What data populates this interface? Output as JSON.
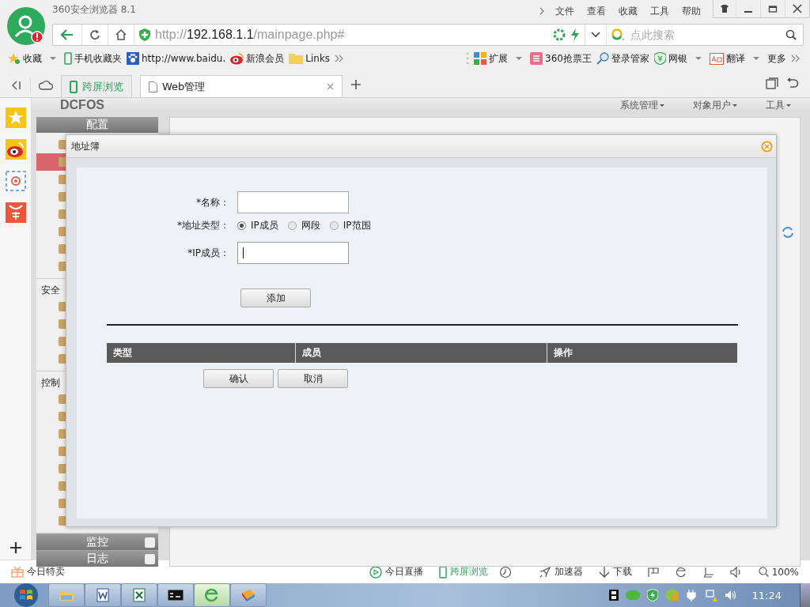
{
  "browser": {
    "title": "360安全浏览器 8.1",
    "menu": [
      "文件",
      "查看",
      "收藏",
      "工具",
      "帮助"
    ]
  },
  "address_bar": {
    "url": "http://**192.168.1.1**/mainpage.php#",
    "search": {
      "placeholder": "点此搜索"
    }
  },
  "bookmarks": {
    "left": [
      {
        "kind": "star",
        "label": "收藏",
        "dropdown": true
      },
      {
        "kind": "phone",
        "label": "手机收藏夹",
        "dropdown": false
      },
      {
        "kind": "paw",
        "label": "http://www.baidu.",
        "dropdown": false
      },
      {
        "kind": "eye",
        "label": "新浪会员",
        "dropdown": false
      },
      {
        "kind": "folder",
        "label": "Links",
        "dropdown": false
      }
    ],
    "right": [
      {
        "kind": "grid",
        "label": "扩展",
        "dropdown": true
      },
      {
        "kind": "ticket",
        "label": "360抢票王",
        "dropdown": false
      },
      {
        "kind": "key",
        "label": "登录管家",
        "dropdown": false
      },
      {
        "kind": "shield",
        "label": "网银",
        "dropdown": true
      },
      {
        "kind": "translate",
        "label": "翻译",
        "dropdown": true
      },
      {
        "kind": "more",
        "label": "更多",
        "dropdown": false
      }
    ]
  },
  "tabs": [
    {
      "kind": "app",
      "label": "跨屏浏览",
      "selected": false
    },
    {
      "kind": "page",
      "label": "Web管理",
      "selected": true
    }
  ],
  "page": {
    "logo": "DCFOS",
    "menu": [
      "系统管理",
      "对象用户",
      "工具"
    ],
    "nav": [
      {
        "kind": "header",
        "label": "配置"
      },
      {
        "kind": "section",
        "label": "安全"
      },
      {
        "kind": "section",
        "label": "控制"
      },
      {
        "kind": "footer",
        "label": "监控"
      },
      {
        "kind": "footer",
        "label": "日志"
      }
    ]
  },
  "dialog": {
    "title": "地址簿",
    "fields": [
      {
        "kind": "text",
        "label": "*名称："
      },
      {
        "kind": "radio",
        "label": "*地址类型：",
        "options": [
          {
            "label": "IP成员",
            "selected": true
          },
          {
            "label": "网段",
            "selected": false
          },
          {
            "label": "IP范围",
            "selected": false
          }
        ]
      },
      {
        "kind": "text",
        "label": "*IP成员：",
        "focused": true
      }
    ],
    "add_button": "添加",
    "table": {
      "columns": [
        "类型",
        "成员",
        "操作"
      ]
    },
    "buttons": [
      "确认",
      "取消"
    ]
  },
  "status_bar": {
    "left": "今日特卖",
    "right": [
      {
        "kind": "live",
        "label": "今日直播"
      },
      {
        "kind": "cross",
        "label": "跨屏浏览"
      },
      {
        "kind": "clock"
      },
      {
        "kind": "rocket",
        "label": "加速器"
      },
      {
        "kind": "download",
        "label": "下载"
      },
      {
        "kind": "flag"
      },
      {
        "kind": "ie"
      },
      {
        "kind": "window"
      },
      {
        "kind": "sound"
      },
      {
        "kind": "zoom",
        "label": "100%"
      }
    ]
  },
  "taskbar": {
    "clock": "11:24"
  }
}
